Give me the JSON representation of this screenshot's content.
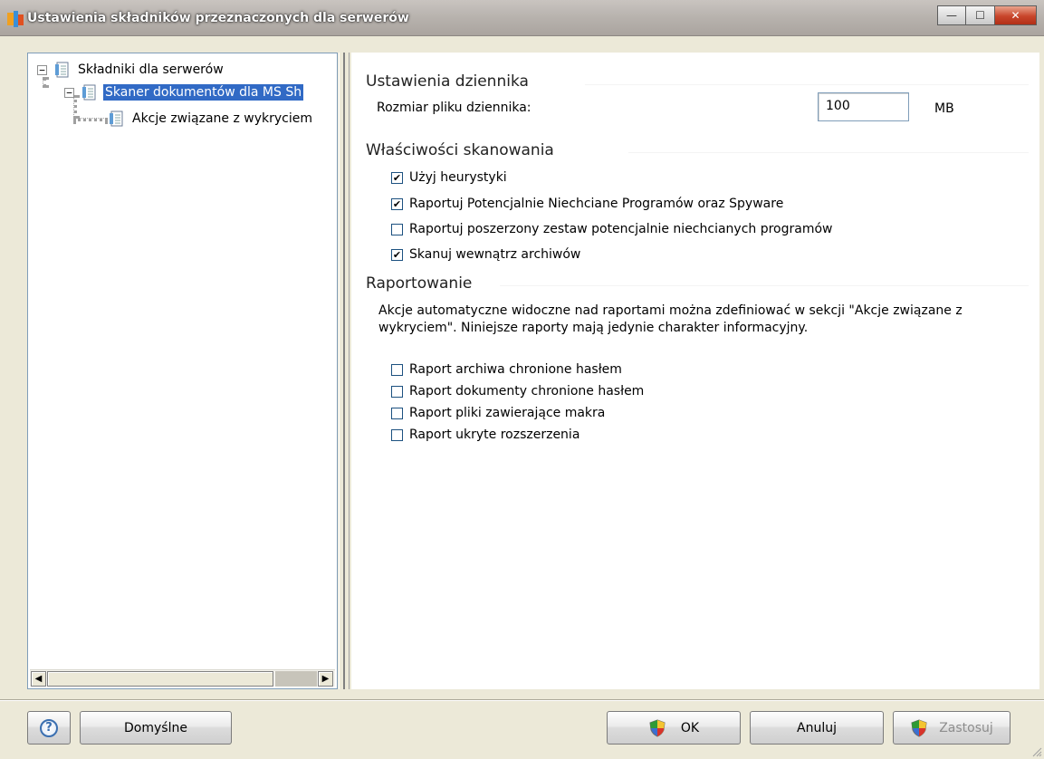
{
  "window": {
    "title": "Ustawienia składników przeznaczonych dla serwerów",
    "minimize_glyph": "—",
    "maximize_glyph": "☐",
    "close_glyph": "✕"
  },
  "tree": {
    "items": [
      {
        "label": "Składniki dla serwerów",
        "expander": "−",
        "selected": false
      },
      {
        "label": "Skaner dokumentów dla MS Sh",
        "expander": "−",
        "selected": true
      },
      {
        "label": "Akcje związane z wykryciem",
        "expander": "",
        "selected": false
      }
    ],
    "scroll_left_glyph": "◀",
    "scroll_right_glyph": "▶"
  },
  "log_settings": {
    "heading": "Ustawienia dziennika",
    "size_label": "Rozmiar pliku dziennika:",
    "size_value": "100",
    "size_unit": "MB"
  },
  "scan_properties": {
    "heading": "Właściwości skanowania",
    "options": [
      {
        "label": "Użyj heurystyki",
        "checked": true
      },
      {
        "label": "Raportuj Potencjalnie Niechciane Programów oraz Spyware",
        "checked": true
      },
      {
        "label": "Raportuj poszerzony zestaw potencjalnie niechcianych programów",
        "checked": false
      },
      {
        "label": "Skanuj wewnątrz archiwów",
        "checked": true
      }
    ]
  },
  "reporting": {
    "heading": "Raportowanie",
    "description": "Akcje automatyczne widoczne nad raportami można zdefiniować w sekcji \"Akcje związane z wykryciem\". Niniejsze raporty mają jedynie charakter informacyjny.",
    "options": [
      {
        "label": "Raport archiwa chronione hasłem",
        "checked": false
      },
      {
        "label": "Raport dokumenty chronione hasłem",
        "checked": false
      },
      {
        "label": "Raport pliki zawierające makra",
        "checked": false
      },
      {
        "label": "Raport ukryte rozszerzenia",
        "checked": false
      }
    ]
  },
  "buttons": {
    "help_glyph": "?",
    "defaults": "Domyślne",
    "ok": "OK",
    "cancel": "Anuluj",
    "apply": "Zastosuj"
  },
  "check_glyph": "✔"
}
